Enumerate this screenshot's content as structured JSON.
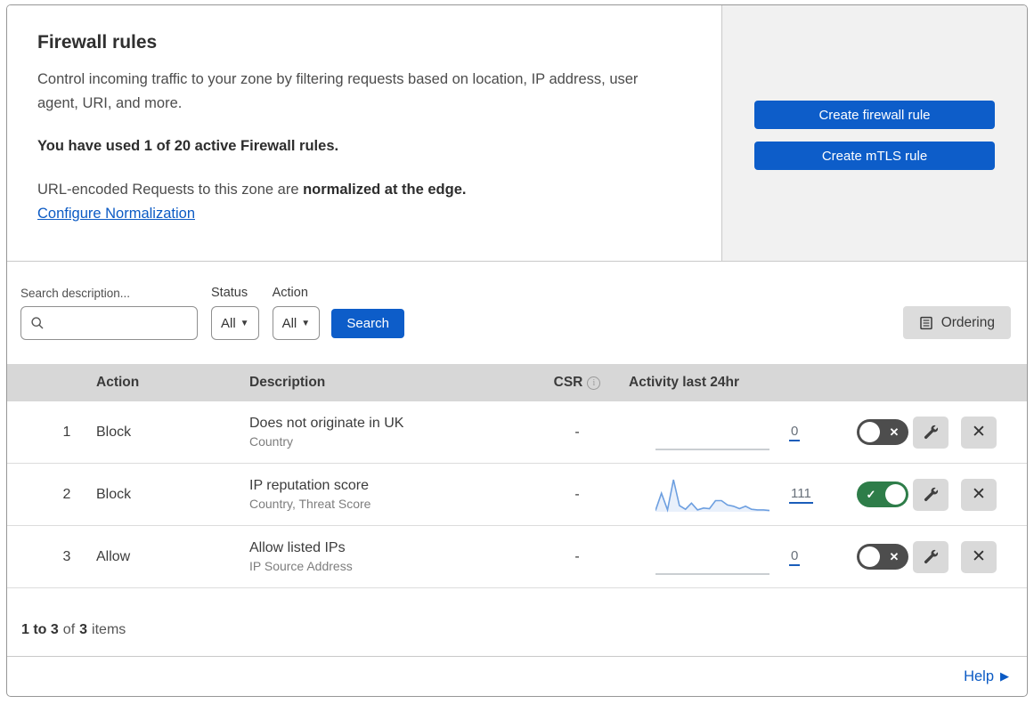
{
  "intro": {
    "title": "Firewall rules",
    "description": "Control incoming traffic to your zone by filtering requests based on location, IP address, user agent, URI, and more.",
    "usage": "You have used 1 of 20 active Firewall rules.",
    "normalization_prefix": "URL-encoded Requests to this zone are ",
    "normalization_bold": "normalized at the edge.",
    "normalization_link": "Configure Normalization"
  },
  "actions": {
    "create_firewall_rule": "Create firewall rule",
    "create_mtls_rule": "Create mTLS rule"
  },
  "filters": {
    "search_label": "Search description...",
    "status_label": "Status",
    "status_value": "All",
    "action_label": "Action",
    "action_value": "All",
    "search_button": "Search",
    "ordering_button": "Ordering"
  },
  "table": {
    "headers": {
      "action": "Action",
      "description": "Description",
      "csr": "CSR",
      "activity": "Activity last 24hr"
    },
    "rows": [
      {
        "number": "1",
        "action": "Block",
        "description": "Does not originate in UK",
        "criteria": "Country",
        "csr": "-",
        "activity_count": "0",
        "enabled": false,
        "spark": [
          0
        ]
      },
      {
        "number": "2",
        "action": "Block",
        "description": "IP reputation score",
        "criteria": "Country, Threat Score",
        "csr": "-",
        "activity_count": "111",
        "enabled": true,
        "spark": [
          2,
          30,
          3,
          52,
          10,
          4,
          14,
          3,
          6,
          5,
          18,
          18,
          11,
          9,
          5,
          9,
          4,
          3,
          3,
          2
        ]
      },
      {
        "number": "3",
        "action": "Allow",
        "description": "Allow listed IPs",
        "criteria": "IP Source Address",
        "csr": "-",
        "activity_count": "0",
        "enabled": false,
        "spark": [
          0
        ]
      }
    ]
  },
  "footer": {
    "range": "1 to 3",
    "of": "of",
    "total": "3",
    "items": "items"
  },
  "help": {
    "label": "Help"
  },
  "colors": {
    "accent_blue": "#0d5dc9",
    "link_blue": "#0b5ac4",
    "toggle_on_green": "#2e7d49",
    "toggle_off_grey": "#4d4d4d",
    "spark_line_blue": "#6d9fe0",
    "table_header_grey": "#d7d7d7",
    "panel_grey": "#f1f1f1"
  }
}
